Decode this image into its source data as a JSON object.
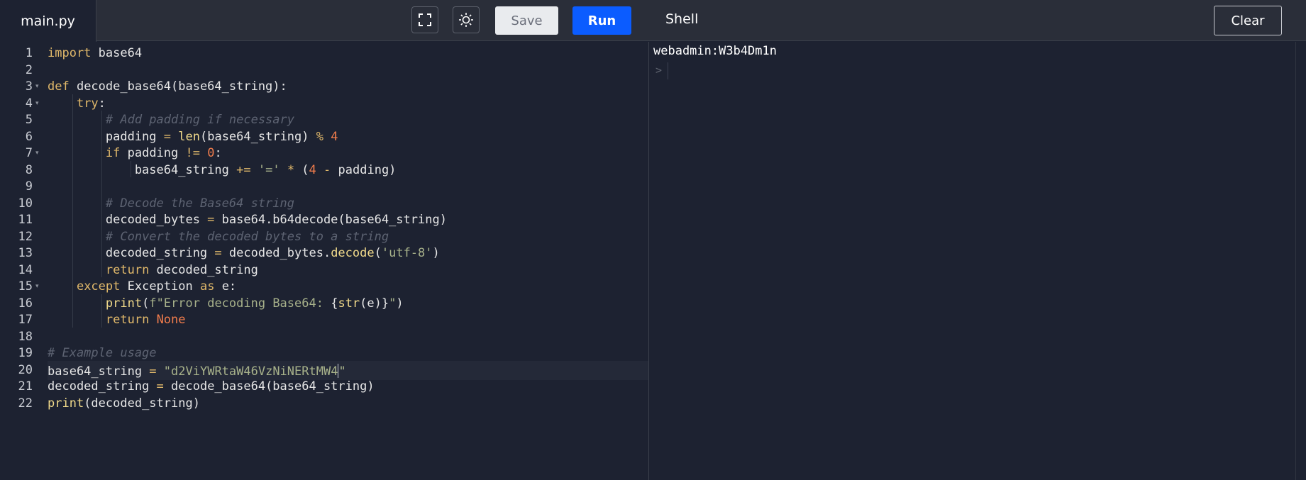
{
  "header": {
    "file_tab": "main.py",
    "save_label": "Save",
    "run_label": "Run",
    "shell_title": "Shell",
    "clear_label": "Clear",
    "icons": [
      "fullscreen-icon",
      "theme-toggle-icon"
    ]
  },
  "editor": {
    "line_numbers": [
      "1",
      "2",
      "3",
      "4",
      "5",
      "6",
      "7",
      "8",
      "9",
      "10",
      "11",
      "12",
      "13",
      "14",
      "15",
      "16",
      "17",
      "18",
      "19",
      "20",
      "21",
      "22"
    ],
    "folded_lines": [
      3,
      4,
      7,
      15
    ],
    "active_line": 20,
    "code": [
      [
        [
          "kw",
          "import"
        ],
        [
          "t",
          " base64"
        ]
      ],
      [],
      [
        [
          "kw",
          "def"
        ],
        [
          "t",
          " decode_base64(base64_string):"
        ]
      ],
      [
        [
          "t",
          "    "
        ],
        [
          "kw",
          "try"
        ],
        [
          "t",
          ":"
        ]
      ],
      [
        [
          "t",
          "        "
        ],
        [
          "cmt",
          "# Add padding if necessary"
        ]
      ],
      [
        [
          "t",
          "        padding "
        ],
        [
          "op",
          "="
        ],
        [
          "t",
          " "
        ],
        [
          "bi",
          "len"
        ],
        [
          "t",
          "(base64_string) "
        ],
        [
          "op",
          "%"
        ],
        [
          "t",
          " "
        ],
        [
          "num",
          "4"
        ]
      ],
      [
        [
          "t",
          "        "
        ],
        [
          "kw",
          "if"
        ],
        [
          "t",
          " padding "
        ],
        [
          "op",
          "!="
        ],
        [
          "t",
          " "
        ],
        [
          "num",
          "0"
        ],
        [
          "t",
          ":"
        ]
      ],
      [
        [
          "t",
          "            base64_string "
        ],
        [
          "op",
          "+="
        ],
        [
          "t",
          " "
        ],
        [
          "str",
          "'='"
        ],
        [
          "t",
          " "
        ],
        [
          "op",
          "*"
        ],
        [
          "t",
          " ("
        ],
        [
          "num",
          "4"
        ],
        [
          "t",
          " "
        ],
        [
          "op",
          "-"
        ],
        [
          "t",
          " padding)"
        ]
      ],
      [],
      [
        [
          "t",
          "        "
        ],
        [
          "cmt",
          "# Decode the Base64 string"
        ]
      ],
      [
        [
          "t",
          "        decoded_bytes "
        ],
        [
          "op",
          "="
        ],
        [
          "t",
          " base64.b64decode(base64_string)"
        ]
      ],
      [
        [
          "t",
          "        "
        ],
        [
          "cmt",
          "# Convert the decoded bytes to a string"
        ]
      ],
      [
        [
          "t",
          "        decoded_string "
        ],
        [
          "op",
          "="
        ],
        [
          "t",
          " decoded_bytes."
        ],
        [
          "bi",
          "decode"
        ],
        [
          "t",
          "("
        ],
        [
          "str",
          "'utf-8'"
        ],
        [
          "t",
          ")"
        ]
      ],
      [
        [
          "t",
          "        "
        ],
        [
          "kw",
          "return"
        ],
        [
          "t",
          " decoded_string"
        ]
      ],
      [
        [
          "t",
          "    "
        ],
        [
          "kw",
          "except"
        ],
        [
          "t",
          " Exception "
        ],
        [
          "kw",
          "as"
        ],
        [
          "t",
          " e:"
        ]
      ],
      [
        [
          "t",
          "        "
        ],
        [
          "bi",
          "print"
        ],
        [
          "t",
          "("
        ],
        [
          "str",
          "f\"Error decoding Base64: "
        ],
        [
          "t",
          "{"
        ],
        [
          "bi",
          "str"
        ],
        [
          "t",
          "(e)}"
        ],
        [
          "str",
          "\""
        ],
        [
          "t",
          ")"
        ]
      ],
      [
        [
          "t",
          "        "
        ],
        [
          "kw",
          "return"
        ],
        [
          "t",
          " "
        ],
        [
          "none",
          "None"
        ]
      ],
      [],
      [
        [
          "cmt",
          "# Example usage"
        ]
      ],
      [
        [
          "t",
          "base64_string "
        ],
        [
          "op",
          "="
        ],
        [
          "t",
          " "
        ],
        [
          "str",
          "\"d2ViYWRtaW46VzNiNERtMW4"
        ],
        [
          "caret",
          ""
        ],
        [
          "str",
          "\""
        ]
      ],
      [
        [
          "t",
          "decoded_string "
        ],
        [
          "op",
          "="
        ],
        [
          "t",
          " decode_base64(base64_string)"
        ]
      ],
      [
        [
          "bi",
          "print"
        ],
        [
          "t",
          "(decoded_string)"
        ]
      ]
    ]
  },
  "shell": {
    "output": "webadmin:W3b4Dm1n",
    "prompt": ">"
  }
}
